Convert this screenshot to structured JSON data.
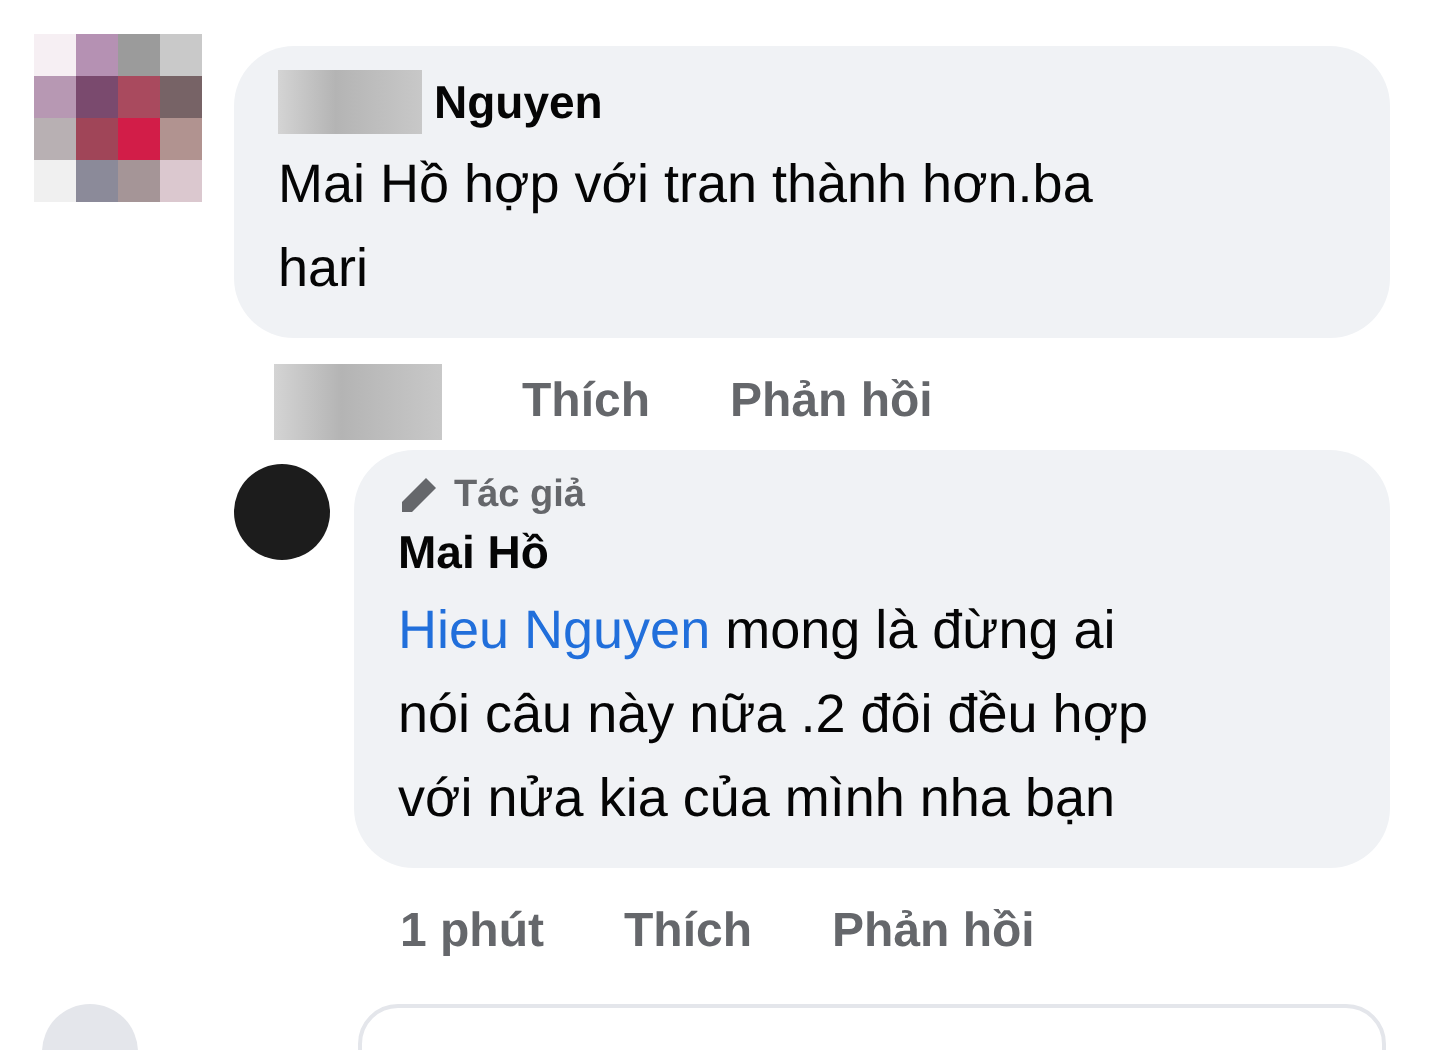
{
  "comment": {
    "name": "Nguyen",
    "text": "Mai Hồ hợp với tran thành hơn.ba hari",
    "actions": [
      "Thích",
      "Phản hồi"
    ]
  },
  "reply": {
    "badge": "Tác giả",
    "name": "Mai Hồ",
    "mention": "Hieu Nguyen",
    "text": "mong là đừng ai nói câu này nữa .2 đôi đều hợp với nửa kia của mình nha bạn",
    "time": "1 phút",
    "actions": [
      "Thích",
      "Phản hồi"
    ]
  }
}
